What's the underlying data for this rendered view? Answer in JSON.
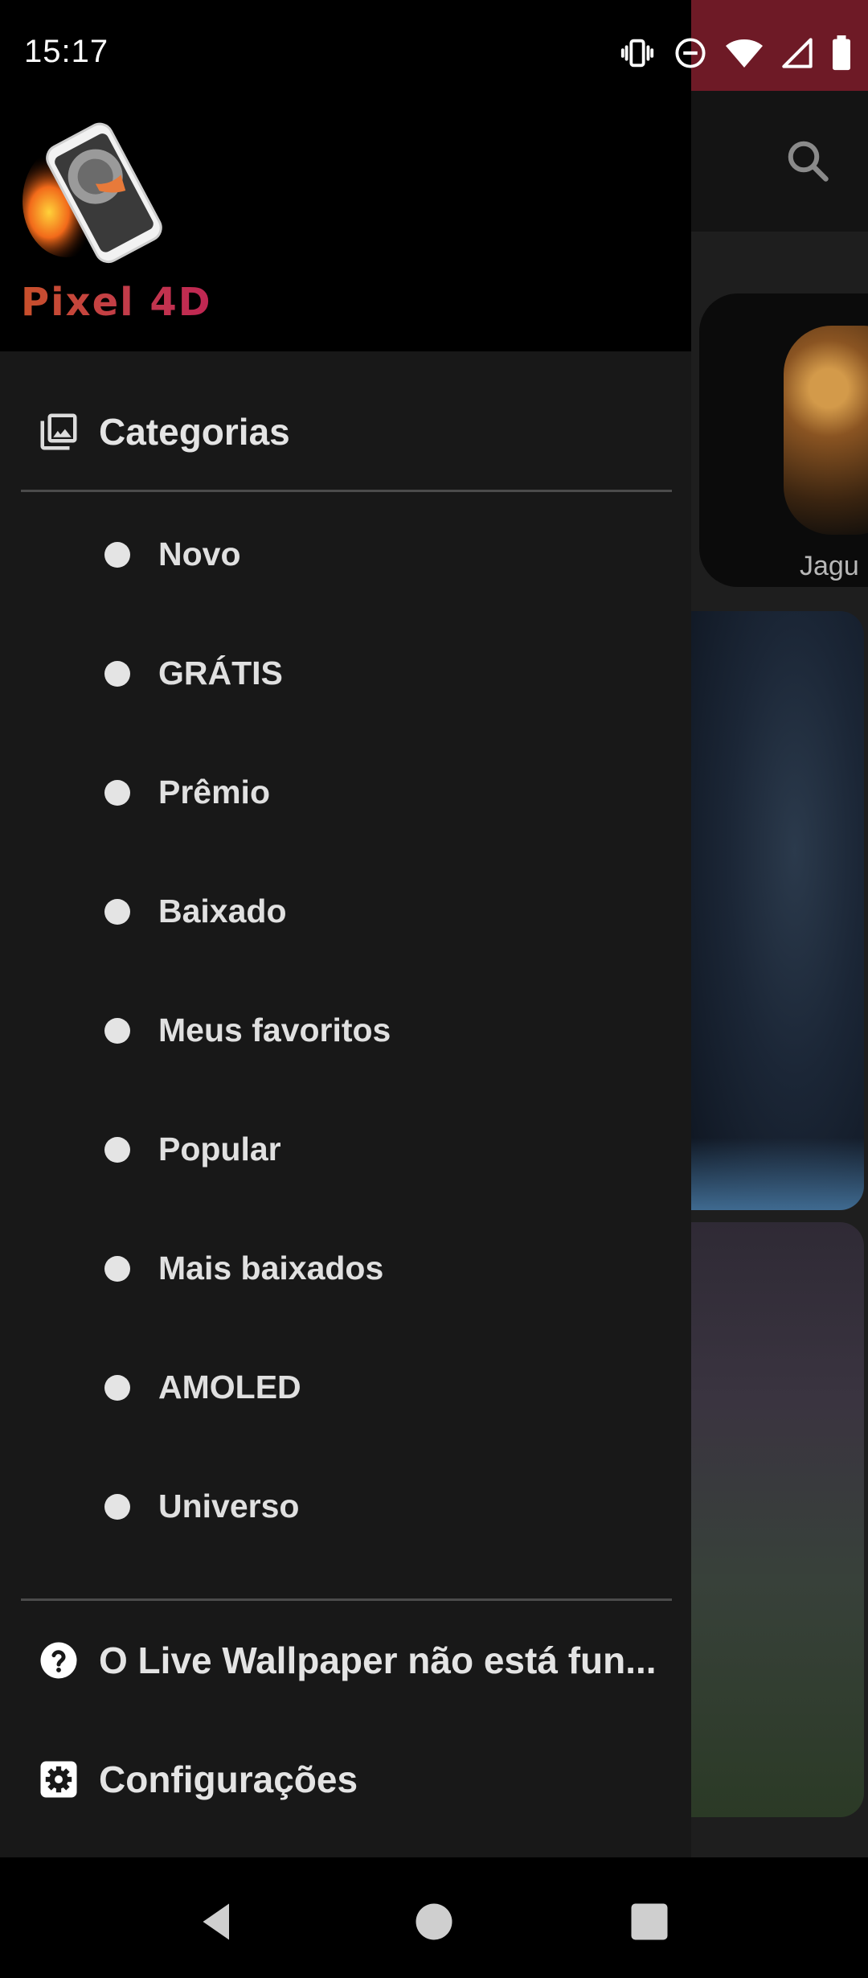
{
  "status_bar": {
    "time": "15:17",
    "icons": [
      "vibrate-icon",
      "do-not-disturb-icon",
      "wifi-icon",
      "signal-icon",
      "battery-icon"
    ]
  },
  "drawer": {
    "app_name": "Pixel 4D",
    "categories_header": "Categorias",
    "categories": [
      {
        "label": "Novo"
      },
      {
        "label": "GRÁTIS"
      },
      {
        "label": "Prêmio"
      },
      {
        "label": "Baixado"
      },
      {
        "label": "Meus favoritos"
      },
      {
        "label": "Popular"
      },
      {
        "label": "Mais baixados"
      },
      {
        "label": "AMOLED"
      },
      {
        "label": "Universo"
      }
    ],
    "help_item": "O Live Wallpaper não está fun...",
    "settings_item": "Configurações"
  },
  "background": {
    "card_label": "Jagu"
  },
  "colors": {
    "drawer_bg": "#181818",
    "header_bg": "#000000",
    "accent": "#6e1a26",
    "brand_gradient": [
      "#c8502b",
      "#c02553"
    ]
  }
}
